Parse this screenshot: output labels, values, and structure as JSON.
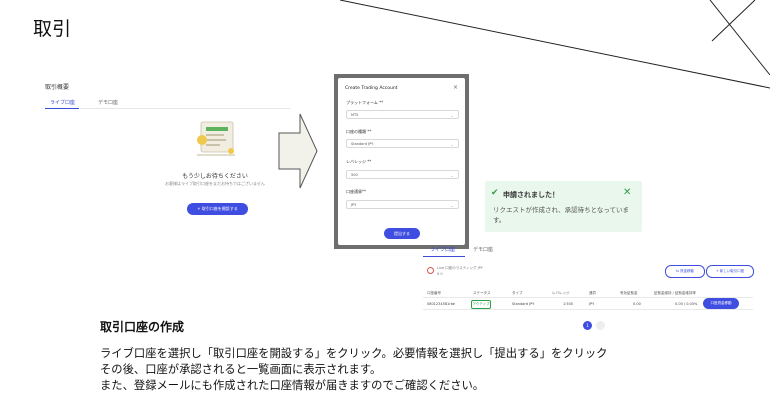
{
  "slide": {
    "title": "取引",
    "caption_title": "取引口座の作成",
    "caption_lines": [
      "ライブ口座を選択し「取引口座を開設する」をクリック。必要情報を選択し「提出する」をクリック",
      "その後、口座が承認されると一覧画面に表示されます。",
      "また、登録メールにも作成された口座情報が届きますのでご確認ください。"
    ]
  },
  "left_panel": {
    "heading": "取引概要",
    "tabs": [
      "ライブ口座",
      "デモ口座"
    ],
    "active_tab": "ライブ口座",
    "empty_title": "もう少しお待ちください",
    "empty_desc": "お客様はライブ取引口座をまだお持ちではございません",
    "open_button": "+ 取引口座を開設する"
  },
  "modal": {
    "title": "Create Trading Account",
    "close": "×",
    "fields": [
      {
        "label": "プラットフォーム **",
        "value": "MT5"
      },
      {
        "label": "口座の種類 **",
        "value": "Standard JPY"
      },
      {
        "label": "レバレッジ **",
        "value": "500"
      },
      {
        "label": "口座通貨**",
        "value": "JPY"
      }
    ],
    "submit": "提出する"
  },
  "notification": {
    "icon": "check-icon",
    "title": "申請されました！",
    "body": "リクエストが作成され、承認待ちとなっています。",
    "close": "✕",
    "color": "#2e9e46"
  },
  "list_screen": {
    "tabs": [
      "ライブ口座",
      "デモ口座"
    ],
    "account_line1": "Live 口座のラスティング JPY",
    "account_line2": "¥ 0",
    "fund_move_button": "⇆ 資金移動",
    "new_account_button": "+ 新しい取引口座",
    "columns": [
      "口座番号",
      "ステータス",
      "タイプ",
      "レバレッジ",
      "通貨",
      "有効証拠金",
      "証拠金維持 / 証拠金維持率"
    ],
    "row": {
      "account": "0801234581rbe",
      "status": "アクティブ",
      "type": "Standard JPY",
      "leverage": "1:500",
      "currency": "JPY",
      "equity": "0.00",
      "margin": "0.00 / 0.00%",
      "action": "口座資金移動"
    },
    "page": "1"
  },
  "colors": {
    "accent": "#3f4ee0",
    "success": "#2e9e46",
    "notice_bg": "#eaf7ec"
  }
}
